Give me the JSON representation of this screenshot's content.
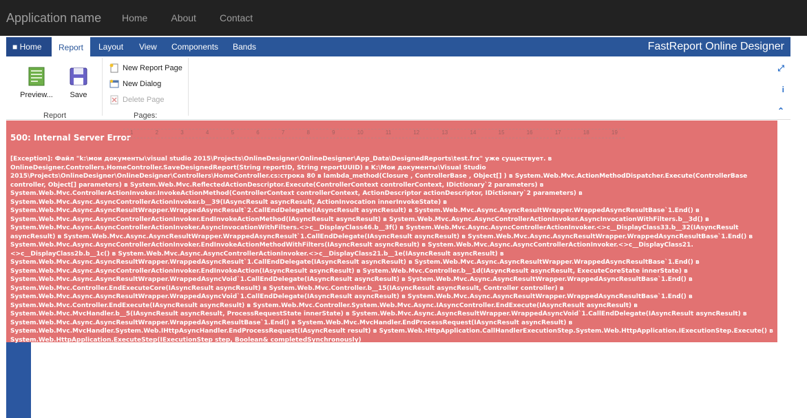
{
  "topnav": {
    "brand": "Application name",
    "links": [
      "Home",
      "About",
      "Contact"
    ]
  },
  "designer": {
    "title": "FastReport Online Designer",
    "tabs": [
      "Home",
      "Report",
      "Layout",
      "View",
      "Components",
      "Bands"
    ],
    "active_tab": "Report",
    "ribbon": {
      "preview_label": "Preview...",
      "save_label": "Save",
      "report_group": "Report",
      "new_report_page": "New Report Page",
      "new_dialog": "New Dialog",
      "delete_page": "Delete Page",
      "pages_group": "Pages:"
    },
    "right_icons": [
      "fullscreen-icon",
      "info-icon",
      "collapse-icon"
    ]
  },
  "ruler": [
    "1",
    "2",
    "3",
    "4",
    "5",
    "6",
    "7",
    "8",
    "9",
    "10",
    "11",
    "12",
    "13",
    "14",
    "15",
    "16",
    "17",
    "18",
    "19"
  ],
  "error": {
    "title": "500: Internal Server Error",
    "message": "[Exception]: Файл \"k:\\мои документы\\visual studio 2015\\Projects\\OnlineDesigner\\OnlineDesigner\\App_Data\\DesignedReports\\test.frx\" уже существует. в OnlineDesigner.Controllers.HomeController.SaveDesignedReport(String reportID, String reportUUID) в K:\\Мои документы\\Visual Studio 2015\\Projects\\OnlineDesigner\\OnlineDesigner\\Controllers\\HomeController.cs:строка 80 в lambda_method(Closure , ControllerBase , Object[] ) в System.Web.Mvc.ActionMethodDispatcher.Execute(ControllerBase controller, Object[] parameters) в System.Web.Mvc.ReflectedActionDescriptor.Execute(ControllerContext controllerContext, IDictionary`2 parameters) в System.Web.Mvc.ControllerActionInvoker.InvokeActionMethod(ControllerContext controllerContext, ActionDescriptor actionDescriptor, IDictionary`2 parameters) в System.Web.Mvc.Async.AsyncControllerActionInvoker.b__39(IAsyncResult asyncResult, ActionInvocation innerInvokeState) в System.Web.Mvc.Async.AsyncResultWrapper.WrappedAsyncResult`2.CallEndDelegate(IAsyncResult asyncResult) в System.Web.Mvc.Async.AsyncResultWrapper.WrappedAsyncResultBase`1.End() в System.Web.Mvc.Async.AsyncControllerActionInvoker.EndInvokeActionMethod(IAsyncResult asyncResult) в System.Web.Mvc.Async.AsyncControllerActionInvoker.AsyncInvocationWithFilters.b__3d() в System.Web.Mvc.Async.AsyncControllerActionInvoker.AsyncInvocationWithFilters.<>c__DisplayClass46.b__3f() в System.Web.Mvc.Async.AsyncControllerActionInvoker.<>c__DisplayClass33.b__32(IAsyncResult asyncResult) в System.Web.Mvc.Async.AsyncResultWrapper.WrappedAsyncResult`1.CallEndDelegate(IAsyncResult asyncResult) в System.Web.Mvc.Async.AsyncResultWrapper.WrappedAsyncResultBase`1.End() в System.Web.Mvc.Async.AsyncControllerActionInvoker.EndInvokeActionMethodWithFilters(IAsyncResult asyncResult) в System.Web.Mvc.Async.AsyncControllerActionInvoker.<>c__DisplayClass21.<>c__DisplayClass2b.b__1c() в System.Web.Mvc.Async.AsyncControllerActionInvoker.<>c__DisplayClass21.b__1e(IAsyncResult asyncResult) в System.Web.Mvc.Async.AsyncResultWrapper.WrappedAsyncResult`1.CallEndDelegate(IAsyncResult asyncResult) в System.Web.Mvc.Async.AsyncResultWrapper.WrappedAsyncResultBase`1.End() в System.Web.Mvc.Async.AsyncControllerActionInvoker.EndInvokeAction(IAsyncResult asyncResult) в System.Web.Mvc.Controller.b__1d(IAsyncResult asyncResult, ExecuteCoreState innerState) в System.Web.Mvc.Async.AsyncResultWrapper.WrappedAsyncVoid`1.CallEndDelegate(IAsyncResult asyncResult) в System.Web.Mvc.Async.AsyncResultWrapper.WrappedAsyncResultBase`1.End() в System.Web.Mvc.Controller.EndExecuteCore(IAsyncResult asyncResult) в System.Web.Mvc.Controller.b__15(IAsyncResult asyncResult, Controller controller) в System.Web.Mvc.Async.AsyncResultWrapper.WrappedAsyncVoid`1.CallEndDelegate(IAsyncResult asyncResult) в System.Web.Mvc.Async.AsyncResultWrapper.WrappedAsyncResultBase`1.End() в System.Web.Mvc.Controller.EndExecute(IAsyncResult asyncResult) в System.Web.Mvc.Controller.System.Web.Mvc.Async.IAsyncController.EndExecute(IAsyncResult asyncResult) в System.Web.Mvc.MvcHandler.b__5(IAsyncResult asyncResult, ProcessRequestState innerState) в System.Web.Mvc.Async.AsyncResultWrapper.WrappedAsyncVoid`1.CallEndDelegate(IAsyncResult asyncResult) в System.Web.Mvc.Async.AsyncResultWrapper.WrappedAsyncResultBase`1.End() в System.Web.Mvc.MvcHandler.EndProcessRequest(IAsyncResult asyncResult) в System.Web.Mvc.MvcHandler.System.Web.IHttpAsyncHandler.EndProcessRequest(IAsyncResult result) в System.Web.HttpApplication.CallHandlerExecutionStep.System.Web.HttpApplication.IExecutionStep.Execute() в System.Web.HttpApplication.ExecuteStep(IExecutionStep step, Boolean& completedSynchronously)"
  },
  "colors": {
    "nav_bg": "#222222",
    "ribbon_blue": "#2a5699",
    "error_bg": "#e27272"
  }
}
